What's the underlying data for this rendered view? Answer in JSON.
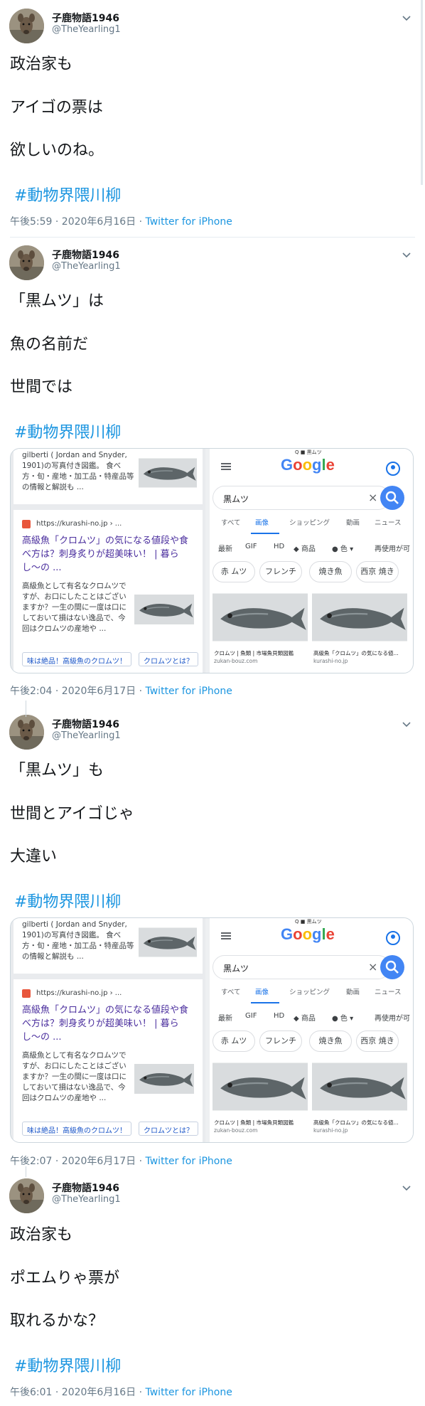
{
  "tweets": [
    {
      "name": "子鹿物語1946",
      "handle": "@TheYearling1",
      "lines": [
        "政治家も",
        "アイゴの票は",
        "欲しいのね。"
      ],
      "hashtag": "#動物界隈川柳",
      "time": "午後5:59 · 2020年6月16日 · ",
      "via": "Twitter for iPhone"
    },
    {
      "name": "子鹿物語1946",
      "handle": "@TheYearling1",
      "lines": [
        "「黒ムツ」は",
        "魚の名前だ",
        "世間では"
      ],
      "hashtag": "#動物界隈川柳",
      "time": "午後2:04 · 2020年6月17日 · ",
      "via": "Twitter for iPhone"
    },
    {
      "name": "子鹿物語1946",
      "handle": "@TheYearling1",
      "lines": [
        "「黒ムツ」も",
        "世間とアイゴじゃ",
        "大違い"
      ],
      "hashtag": "#動物界隈川柳",
      "time": "午後2:07 · 2020年6月17日 · ",
      "via": "Twitter for iPhone"
    },
    {
      "name": "子鹿物語1946",
      "handle": "@TheYearling1",
      "lines": [
        "政治家も",
        "ポエムりゃ票が",
        "取れるかな？"
      ],
      "hashtag": "#動物界隈川柳",
      "time": "午後6:01 · 2020年6月16日 · ",
      "via": "Twitter for iPhone"
    }
  ],
  "screenshot": {
    "left": {
      "top_text": "gilberti ( Jordan and Snyder, 1901)の写真付き図鑑。 食べ方・旬・産地・加工品・特産品等の情報と解説も ...",
      "site_url": "https://kurashi-no.jp › ...",
      "result_title": "高級魚「クロムツ」の気になる値段や食べ方は？刺身炙りが超美味い！ | 暮らし〜の ...",
      "result_snippet": "高級魚として有名なクロムツですが、お口にしたことはございますか？一生の間に一度は口にしておいて損はない逸品で、今回はクロムツの産地や ...",
      "chips": [
        "味は絶品！高級魚のクロムツ！",
        "クロムツとは？"
      ]
    },
    "right": {
      "top_bar": "Q ■ 黒ムツ",
      "logo": [
        "G",
        "o",
        "o",
        "g",
        "l",
        "e"
      ],
      "logo_colors": [
        "#4285f4",
        "#ea4335",
        "#fbbc05",
        "#4285f4",
        "#34a853",
        "#ea4335"
      ],
      "query": "黒ムツ",
      "clear": "×",
      "tabs": [
        "すべて",
        "画像",
        "ショッピング",
        "動画",
        "ニュース"
      ],
      "filters": [
        "最新",
        "GIF",
        "HD",
        "◆ 商品",
        "● 色 ▾",
        "再使用が可"
      ],
      "pills": [
        "赤 ムツ",
        "フレンチ",
        "焼き魚",
        "西京 焼き"
      ],
      "images": [
        {
          "caption": "クロムツ | 魚類 | 市場魚貝類図鑑",
          "source": "zukan-bouz.com"
        },
        {
          "caption": "高級魚「クロムツ」の気になる値...",
          "source": "kurashi-no.jp"
        }
      ]
    }
  }
}
